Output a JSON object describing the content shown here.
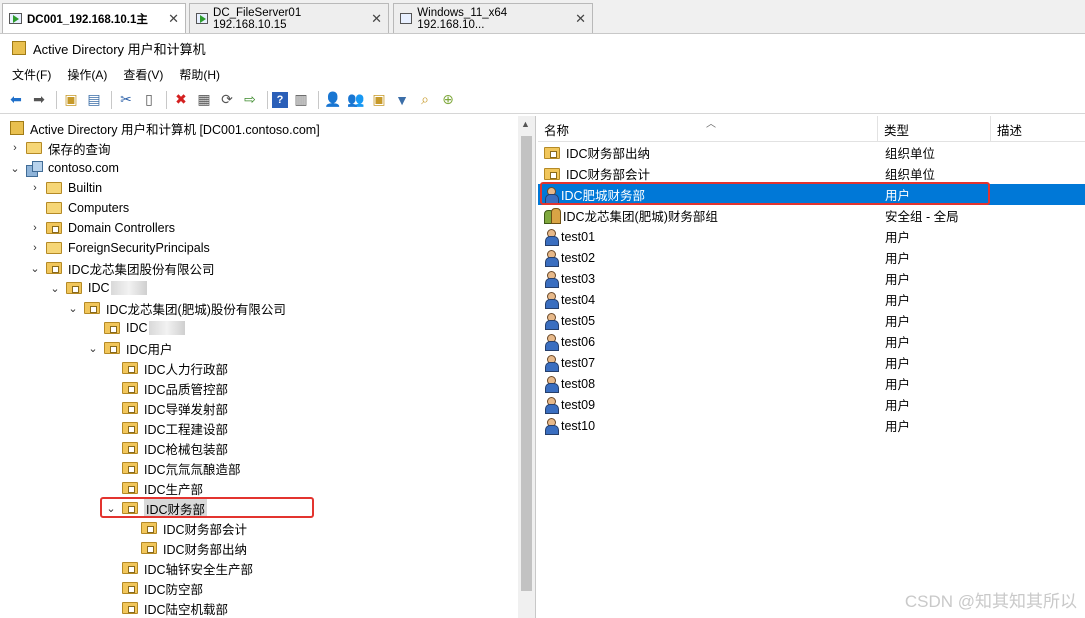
{
  "tabs": [
    {
      "label": "DC001_192.168.10.1主",
      "close": "✕",
      "active": true
    },
    {
      "label": "DC_FileServer01 192.168.10.15",
      "close": "✕",
      "active": false
    },
    {
      "label": "Windows_11_x64 192.168.10...",
      "close": "✕",
      "active": false
    }
  ],
  "window": {
    "title": "Active Directory 用户和计算机"
  },
  "menu": [
    "文件(F)",
    "操作(A)",
    "查看(V)",
    "帮助(H)"
  ],
  "toolbar_icons": [
    "back-arrow-icon",
    "forward-arrow-icon",
    "up-folder-icon",
    "show-tree-icon",
    "cut-icon",
    "copy-icon",
    "delete-icon",
    "properties-icon",
    "refresh-icon",
    "export-list-icon",
    "help-icon",
    "console-icon",
    "new-user-icon",
    "new-group-icon",
    "new-ou-icon",
    "filter-icon",
    "find-icon",
    "add-to-group-icon"
  ],
  "tree": {
    "root": "Active Directory 用户和计算机 [DC001.contoso.com]",
    "saved_queries": "保存的查询",
    "domain": "contoso.com",
    "builtin": "Builtin",
    "computers": "Computers",
    "domain_controllers": "Domain Controllers",
    "foreign": "ForeignSecurityPrincipals",
    "company": "IDC龙芯集团股份有限公司",
    "idc_blurred_1": "IDC",
    "subsidiary": "IDC龙芯集团(肥城)股份有限公司",
    "idc_blurred_2": "IDC",
    "users_ou": "IDC用户",
    "departments": [
      "IDC人力行政部",
      "IDC品质管控部",
      "IDC导弹发射部",
      "IDC工程建设部",
      "IDC枪械包装部",
      "IDC氘氚氚酿造部",
      "IDC生产部"
    ],
    "finance": "IDC财务部",
    "finance_children": [
      "IDC财务部会计",
      "IDC财务部出纳"
    ],
    "after_finance": [
      "IDC轴钚安全生产部",
      "IDC防空部",
      "IDC陆空机载部"
    ]
  },
  "list": {
    "columns": {
      "name": "名称",
      "type": "类型",
      "desc": "描述"
    },
    "rows": [
      {
        "name": "IDC财务部出纳",
        "type": "组织单位",
        "icon": "ou"
      },
      {
        "name": "IDC财务部会计",
        "type": "组织单位",
        "icon": "ou"
      },
      {
        "name": "IDC肥城财务部",
        "type": "用户",
        "icon": "user",
        "selected": true
      },
      {
        "name": "IDC龙芯集团(肥城)财务部组",
        "type": "安全组 - 全局",
        "icon": "group"
      },
      {
        "name": "test01",
        "type": "用户",
        "icon": "user"
      },
      {
        "name": "test02",
        "type": "用户",
        "icon": "user"
      },
      {
        "name": "test03",
        "type": "用户",
        "icon": "user"
      },
      {
        "name": "test04",
        "type": "用户",
        "icon": "user"
      },
      {
        "name": "test05",
        "type": "用户",
        "icon": "user"
      },
      {
        "name": "test06",
        "type": "用户",
        "icon": "user"
      },
      {
        "name": "test07",
        "type": "用户",
        "icon": "user"
      },
      {
        "name": "test08",
        "type": "用户",
        "icon": "user"
      },
      {
        "name": "test09",
        "type": "用户",
        "icon": "user"
      },
      {
        "name": "test10",
        "type": "用户",
        "icon": "user"
      }
    ]
  },
  "watermark": "CSDN @知其知其所以",
  "colors": {
    "selection": "#0078d7",
    "highlight": "#e3342f"
  }
}
